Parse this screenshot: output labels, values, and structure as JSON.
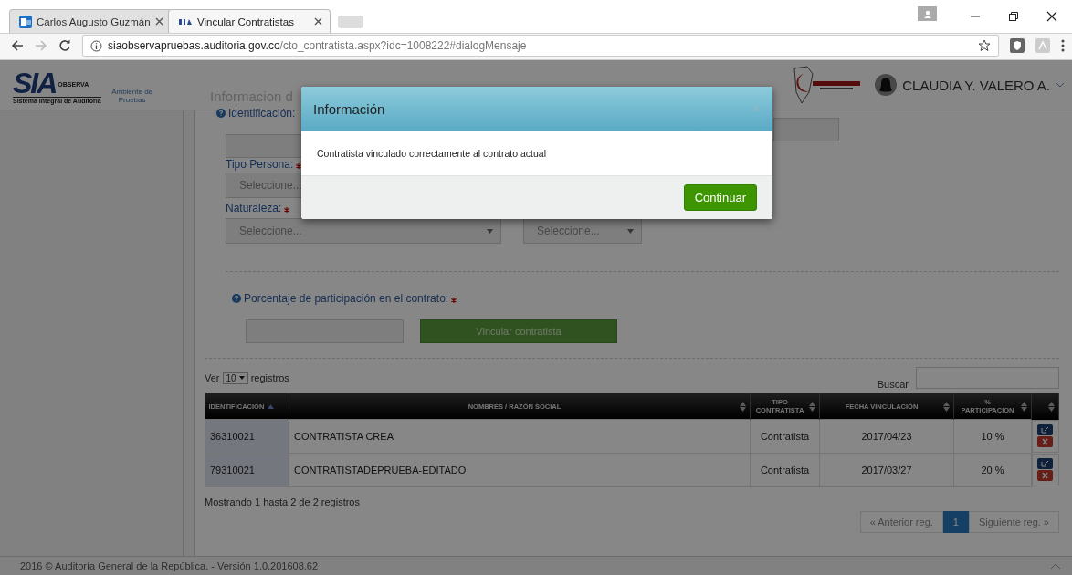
{
  "browser": {
    "tabs": [
      {
        "title": "Carlos Augusto Guzmán",
        "selected": false,
        "kind": "mail"
      },
      {
        "title": "Vincular Contratistas",
        "selected": true,
        "kind": "site"
      }
    ],
    "url_host": "siaobservapruebas.auditoria.gov.co",
    "url_path": "/cto_contratista.aspx?idc=1008222#dialogMensaje"
  },
  "header": {
    "logo_text": "SIA",
    "logo_sub": "OBSERVA",
    "logo_caption": "Sistema Integral de Auditoría",
    "environment": "Ambiente de Pruebas",
    "user_name": "CLAUDIA Y. VALERO A."
  },
  "form": {
    "heading": "Informacion d",
    "id_label": "Identificación:",
    "tipo_label": "Tipo Persona:",
    "tipo_value": "Seleccione...",
    "naturaleza_label": "Naturaleza:",
    "naturaleza_value": "Seleccione...",
    "naturaleza_value_2": "Seleccione...",
    "porcentaje_label": "Porcentaje de participación en el contrato:",
    "submit": "Vincular contratista"
  },
  "table": {
    "length_prefix": "Ver",
    "length_value": "10",
    "length_suffix": "registros",
    "search_label": "Buscar",
    "columns": [
      {
        "label": "IDENTIFICACIÓN",
        "sorted": true
      },
      {
        "label": "NOMBRES / RAZÓN SOCIAL",
        "sorted": false
      },
      {
        "label": "TIPO CONTRATISTA",
        "sorted": false
      },
      {
        "label": "FECHA VINCULACIÓN",
        "sorted": false
      },
      {
        "label": "% PARTICIPACION",
        "sorted": false
      },
      {
        "sorted": false
      }
    ],
    "rows": [
      {
        "cells": [
          "36310021",
          "CONTRATISTA CREA",
          "Contratista",
          "2017/04/23",
          "10 %"
        ]
      },
      {
        "cells": [
          "79310021",
          "CONTRATISTADEPRUEBA-EDITADO",
          "Contratista",
          "2017/03/27",
          "20 %"
        ]
      }
    ],
    "info": "Mostrando 1 hasta 2 de 2 registros",
    "pagination": [
      {
        "label": "« Anterior reg.",
        "selected": false
      },
      {
        "label": "1",
        "selected": true
      },
      {
        "label": "Siguiente reg. »",
        "selected": false
      }
    ]
  },
  "footer": "2016 © Auditoría General de la República. - Versión 1.0.201608.62",
  "dialog": {
    "title": "Información",
    "message": "Contratista vinculado correctamente al contrato actual",
    "button": "Continuar"
  }
}
